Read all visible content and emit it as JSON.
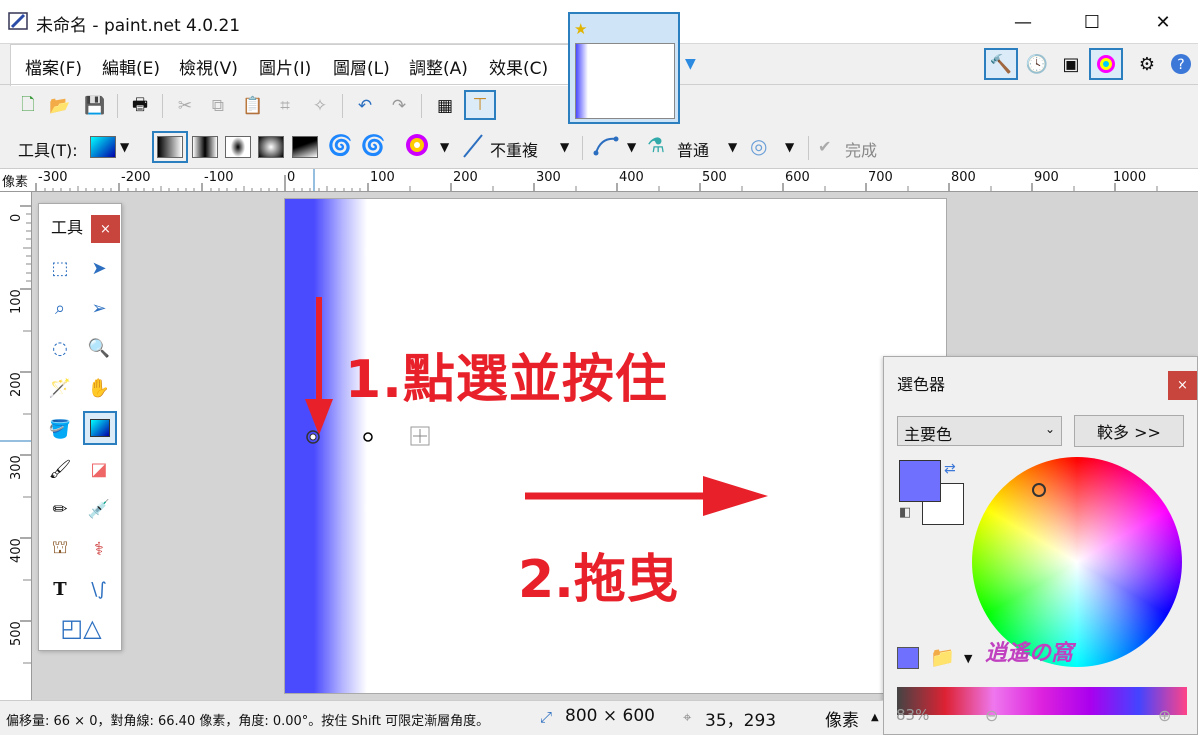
{
  "window": {
    "title": "未命名 - paint.net 4.0.21",
    "minimize": "—",
    "maximize": "☐",
    "close": "✕"
  },
  "menu": [
    "檔案(F)",
    "編輯(E)",
    "檢視(V)",
    "圖片(I)",
    "圖層(L)",
    "調整(A)",
    "效果(C)"
  ],
  "right_icons": [
    "tools-icon",
    "history-icon",
    "layers-icon",
    "colors-icon",
    "settings-icon",
    "help-icon"
  ],
  "toolbar2": {
    "tools_label": "工具(T):",
    "repeat_mode": "不重複",
    "blend_mode": "普通",
    "finish_label": "完成"
  },
  "ruler": {
    "unit": "像素",
    "h_labels": [
      "-300",
      "-200",
      "-100",
      "0",
      "100",
      "200",
      "300",
      "400",
      "500",
      "600",
      "700",
      "800",
      "900",
      "1000"
    ],
    "v_labels": [
      "0",
      "100",
      "200",
      "300",
      "400",
      "500"
    ]
  },
  "annotations": {
    "step1": "1.點選並按住",
    "step2": "2.拖曳"
  },
  "tools_window": {
    "title": "工具",
    "close": "×"
  },
  "colors_window": {
    "title": "選色器",
    "close": "×",
    "select_value": "主要色",
    "more_button": "較多 >>",
    "primary_color": "#7070ff",
    "secondary_color": "#ffffff"
  },
  "status": {
    "message": "偏移量: 66 × 0，對角線: 66.40 像素，角度: 0.00°。按住 Shift 可限定漸層角度。",
    "image_size": "800 × 600",
    "cursor_pos": "35，293",
    "unit": "像素",
    "zoom": "83%"
  },
  "watermark": "逍遙の窩",
  "accent_color": "#2c7fbf"
}
